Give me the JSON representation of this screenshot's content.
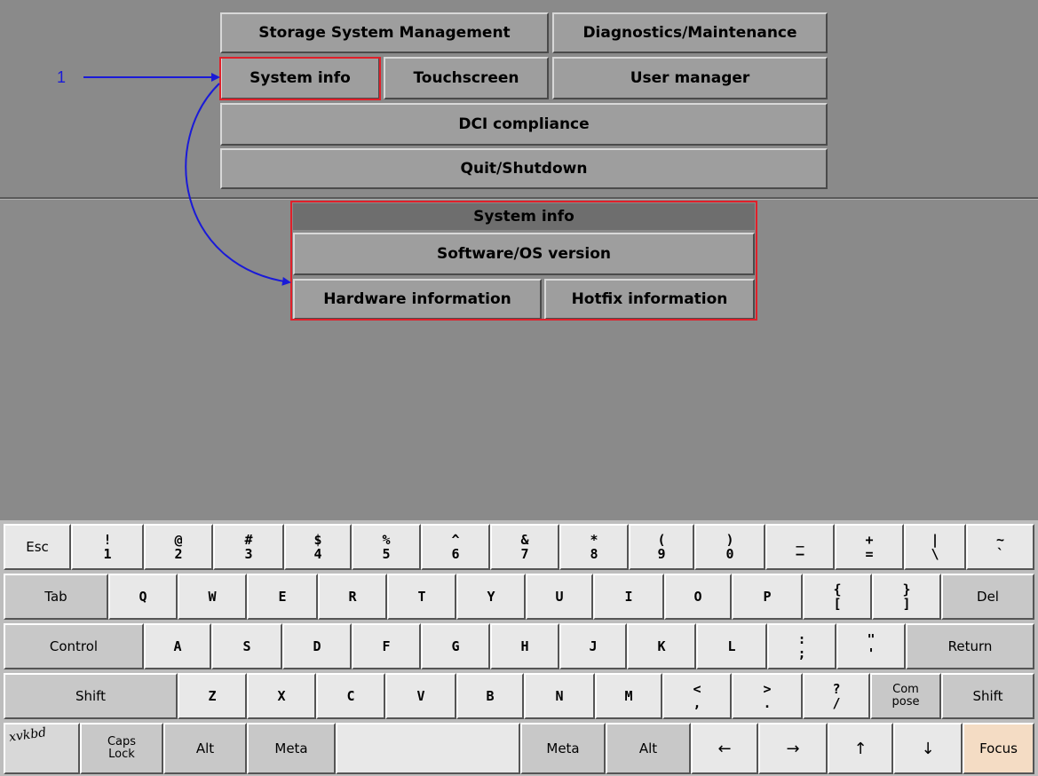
{
  "menu": {
    "storage": "Storage System Management",
    "diagnostics": "Diagnostics/Maintenance",
    "system_info": "System info",
    "touchscreen": "Touchscreen",
    "user_manager": "User manager",
    "dci": "DCI compliance",
    "quit": "Quit/Shutdown"
  },
  "submenu": {
    "title": "System info",
    "software": "Software/OS version",
    "hardware": "Hardware information",
    "hotfix": "Hotfix information"
  },
  "annotation": {
    "label": "1",
    "color": "#1a1ad8",
    "highlight_color": "#e0202a"
  },
  "keyboard": {
    "row1": {
      "esc": "Esc",
      "k1": [
        "!",
        "1"
      ],
      "k2": [
        "@",
        "2"
      ],
      "k3": [
        "#",
        "3"
      ],
      "k4": [
        "$",
        "4"
      ],
      "k5": [
        "%",
        "5"
      ],
      "k6": [
        "^",
        "6"
      ],
      "k7": [
        "&",
        "7"
      ],
      "k8": [
        "*",
        "8"
      ],
      "k9": [
        "(",
        "9"
      ],
      "k0": [
        ")",
        "0"
      ],
      "minus": [
        "_",
        "–"
      ],
      "equal": [
        "+",
        "="
      ],
      "backslash": [
        "|",
        "\\"
      ],
      "tilde": [
        "~",
        "`"
      ]
    },
    "row2": {
      "tab": "Tab",
      "q": "Q",
      "w": "W",
      "e": "E",
      "r": "R",
      "t": "T",
      "y": "Y",
      "u": "U",
      "i": "I",
      "o": "O",
      "p": "P",
      "lbrace": [
        "{",
        "["
      ],
      "rbrace": [
        "}",
        "]"
      ],
      "del": "Del"
    },
    "row3": {
      "control": "Control",
      "a": "A",
      "s": "S",
      "d": "D",
      "f": "F",
      "g": "G",
      "h": "H",
      "j": "J",
      "k": "K",
      "l": "L",
      "colon": [
        ":",
        ";"
      ],
      "quote": [
        "\"",
        "'"
      ],
      "return": "Return"
    },
    "row4": {
      "shift_l": "Shift",
      "z": "Z",
      "x": "X",
      "c": "C",
      "v": "V",
      "b": "B",
      "n": "N",
      "m": "M",
      "lt": [
        "<",
        ","
      ],
      "gt": [
        ">",
        "."
      ],
      "qmark": [
        "?",
        "/"
      ],
      "compose": [
        "Com",
        "pose"
      ],
      "shift_r": "Shift"
    },
    "row5": {
      "logo": "xvkbd",
      "caps": [
        "Caps",
        "Lock"
      ],
      "alt_l": "Alt",
      "meta_l": "Meta",
      "space": "",
      "meta_r": "Meta",
      "alt_r": "Alt",
      "left": "←",
      "right": "→",
      "up": "↑",
      "down": "↓",
      "focus": "Focus"
    }
  }
}
